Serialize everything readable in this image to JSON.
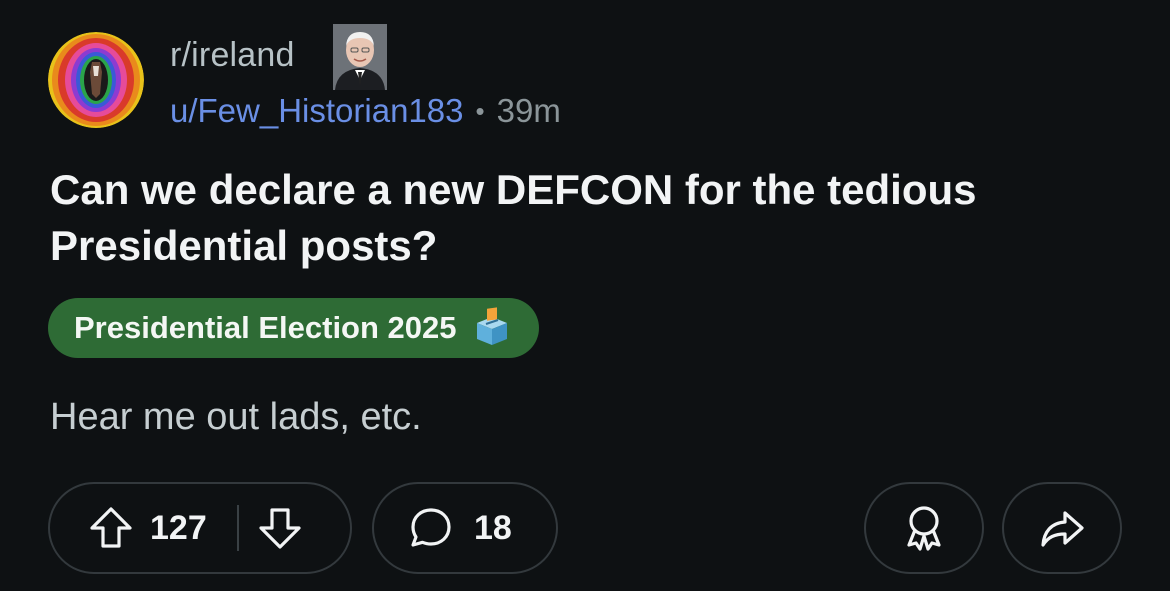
{
  "post": {
    "subreddit": "r/ireland",
    "username": "u/Few_Historian183",
    "separator": "•",
    "age": "39m",
    "title": "Can we declare a new DEFCON for the tedious Presidential posts?",
    "flair": {
      "label": "Presidential Election 2025",
      "emoji": "ballot-box-icon",
      "color": "#2e6b35"
    },
    "body": "Hear me out lads, etc."
  },
  "actions": {
    "upvotes": "127",
    "comments": "18"
  },
  "icons": {
    "upvote": "arrow-up-icon",
    "downvote": "arrow-down-icon",
    "comment": "speech-bubble-icon",
    "award": "award-ribbon-icon",
    "share": "share-arrow-icon"
  },
  "colors": {
    "background": "#0e1113",
    "username": "#6a8fe5",
    "muted": "#8b9599",
    "pill_border": "#33393d"
  }
}
